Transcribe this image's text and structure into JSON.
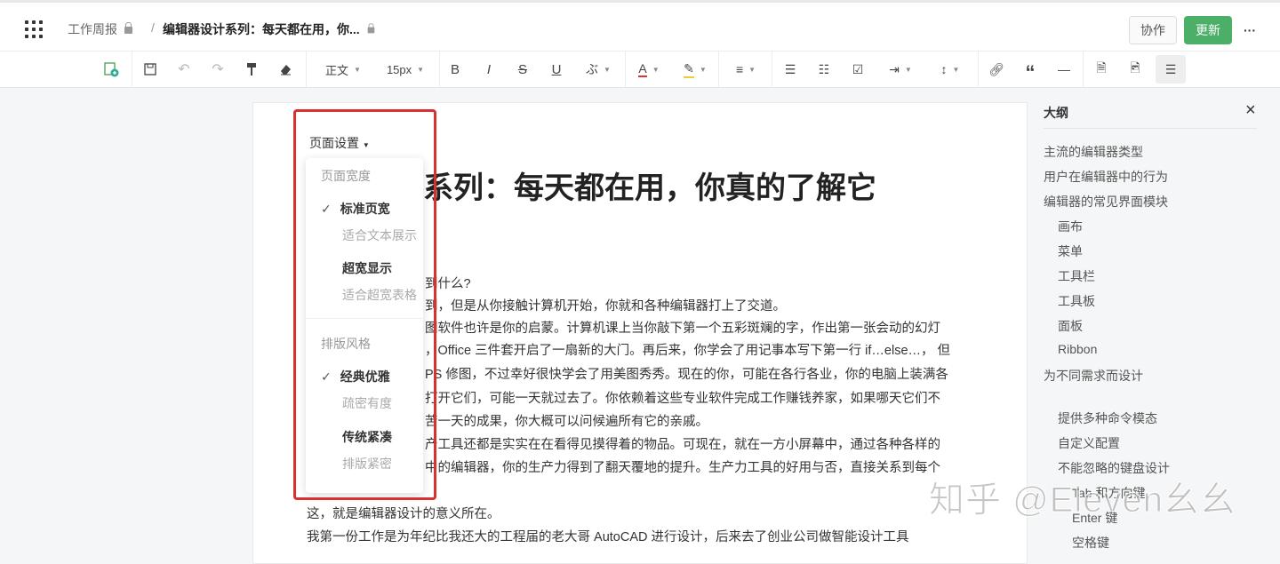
{
  "header": {
    "breadcrumb_parent": "工作周报",
    "breadcrumb_sep": "/",
    "doc_title": "编辑器设计系列：每天都在用，你...",
    "collab": "协作",
    "update": "更新",
    "more": "···",
    "accent": "#4caf68"
  },
  "toolbar": {
    "style": "正文",
    "size": "15px",
    "icons": [
      "new-doc",
      "save",
      "undo",
      "redo",
      "format-painter",
      "eraser",
      "bold",
      "italic",
      "strikethrough",
      "underline",
      "special-char",
      "font-color",
      "highlight",
      "align",
      "bullet-list",
      "ordered-list",
      "checkbox",
      "indent",
      "line-height",
      "link",
      "quote",
      "divider",
      "search-doc",
      "insert-image",
      "outline"
    ]
  },
  "doc": {
    "title": "计系列：每天都在用，你真的了解它",
    "lines": [
      "到什么?",
      "到，但是从你接触计算机开始，你就和各种编辑器打上了交道。",
      "图软件也许是你的启蒙。计算机课上当你敲下第一个五彩斑斓的字，作出第一张会动的幻灯",
      "，Office 三件套开启了一扇新的大门。再后来，你学会了用记事本写下第一行 if…else…， 但",
      "PS 修图，不过幸好很快学会了用美图秀秀。现在的你，可能在各行各业，你的电脑上装满各",
      "打开它们，可能一天就过去了。你依赖着这些专业软件完成工作赚钱养家，如果哪天它们不",
      "苦一天的成果，你大概可以问候遍所有它的亲戚。",
      "产工具还都是实实在在看得见摸得着的物品。可现在，就在一方小屏幕中，通过各种各样的",
      "中的编辑器，你的生产力得到了翻天覆地的提升。生产力工具的好用与否，直接关系到每个"
    ],
    "line10": "这，就是编辑器设计的意义所在。",
    "line11": "我第一份工作是为年纪比我还大的工程届的老大哥 AutoCAD 进行设计，后来去了创业公司做智能设计工具"
  },
  "page_setup": {
    "label": "页面设置",
    "width_heading": "页面宽度",
    "standard": "标准页宽",
    "standard_desc": "适合文本展示",
    "wide": "超宽显示",
    "wide_desc": "适合超宽表格",
    "style_heading": "排版风格",
    "classic": "经典优雅",
    "classic_desc": "疏密有度",
    "compact": "传统紧凑",
    "compact_desc": "排版紧密",
    "check": "✓"
  },
  "outline": {
    "title": "大纲",
    "close": "×",
    "items": [
      {
        "label": "主流的编辑器类型",
        "level": 1
      },
      {
        "label": "用户在编辑器中的行为",
        "level": 1
      },
      {
        "label": "编辑器的常见界面模块",
        "level": 1
      },
      {
        "label": "画布",
        "level": 2
      },
      {
        "label": "菜单",
        "level": 2
      },
      {
        "label": "工具栏",
        "level": 2
      },
      {
        "label": "工具板",
        "level": 2
      },
      {
        "label": "面板",
        "level": 2
      },
      {
        "label": "Ribbon",
        "level": 2
      },
      {
        "label": "为不同需求而设计",
        "level": 1
      },
      {
        "label": "提供多种命令模态",
        "level": 2
      },
      {
        "label": "自定义配置",
        "level": 2
      },
      {
        "label": "不能忽略的键盘设计",
        "level": 2
      },
      {
        "label": "Tab 和方向键",
        "level": 3
      },
      {
        "label": "Enter 键",
        "level": 3
      },
      {
        "label": "空格键",
        "level": 3
      }
    ]
  },
  "watermark": "知乎 @Eleven幺幺"
}
